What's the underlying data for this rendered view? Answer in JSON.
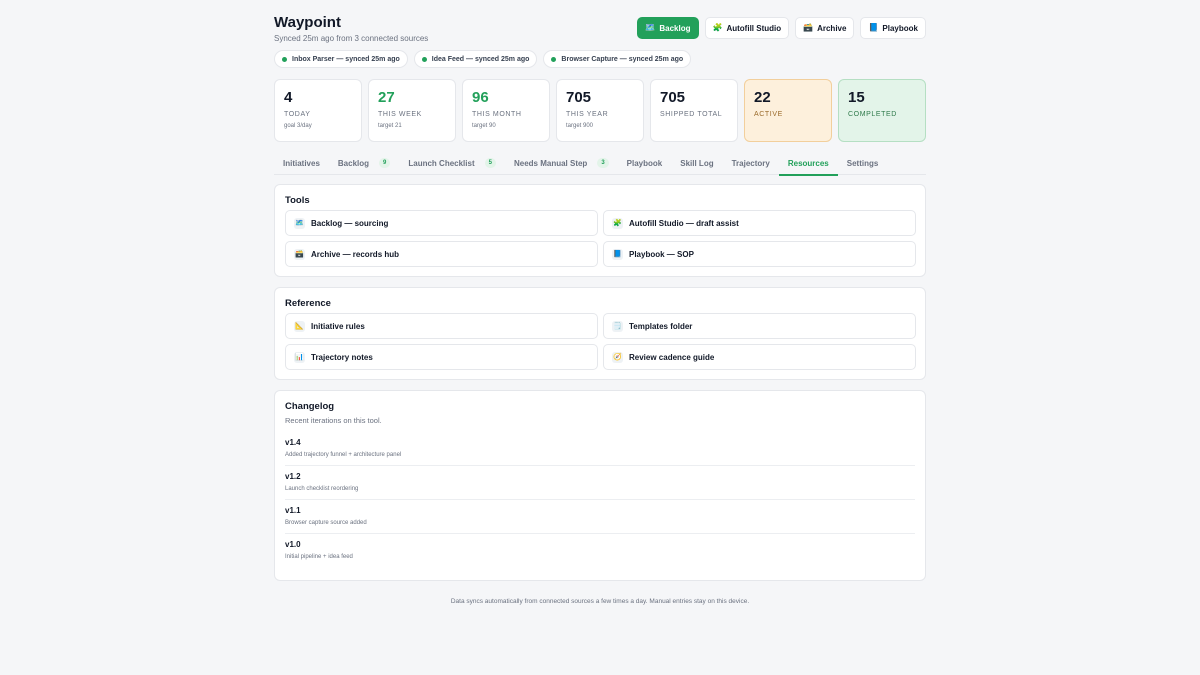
{
  "app": {
    "title": "Waypoint",
    "subtitle": "Synced 25m ago from 3 connected sources"
  },
  "toplinks": [
    {
      "icon": "map-icon",
      "glyph": "🗺️",
      "label": "Backlog",
      "active": true
    },
    {
      "icon": "puzzle-icon",
      "glyph": "🧩",
      "label": "Autofill Studio",
      "active": false
    },
    {
      "icon": "archive-icon",
      "glyph": "🗃️",
      "label": "Archive",
      "active": false
    },
    {
      "icon": "book-icon",
      "glyph": "📘",
      "label": "Playbook",
      "active": false
    }
  ],
  "sources": [
    {
      "label": "Inbox Parser — synced 25m ago"
    },
    {
      "label": "Idea Feed — synced 25m ago"
    },
    {
      "label": "Browser Capture — synced 25m ago"
    }
  ],
  "stats": [
    {
      "value": "4",
      "label": "TODAY",
      "sub": "goal 3/day"
    },
    {
      "value": "27",
      "label": "THIS WEEK",
      "sub": "target 21"
    },
    {
      "value": "96",
      "label": "THIS MONTH",
      "sub": "target 90"
    },
    {
      "value": "705",
      "label": "THIS YEAR",
      "sub": "target 900"
    },
    {
      "value": "705",
      "label": "SHIPPED TOTAL",
      "sub": ""
    },
    {
      "value": "22",
      "label": "ACTIVE",
      "sub": ""
    },
    {
      "value": "15",
      "label": "COMPLETED",
      "sub": ""
    }
  ],
  "tabs": [
    {
      "label": "Initiatives",
      "badge": ""
    },
    {
      "label": "Backlog",
      "badge": "9"
    },
    {
      "label": "Launch Checklist",
      "badge": "5"
    },
    {
      "label": "Needs Manual Step",
      "badge": "3"
    },
    {
      "label": "Playbook",
      "badge": ""
    },
    {
      "label": "Skill Log",
      "badge": ""
    },
    {
      "label": "Trajectory",
      "badge": ""
    },
    {
      "label": "Resources",
      "badge": "",
      "active": true
    },
    {
      "label": "Settings",
      "badge": ""
    }
  ],
  "tools": {
    "heading": "Tools",
    "items": [
      {
        "icon": "map-icon",
        "glyph": "🗺️",
        "label": "Backlog — sourcing"
      },
      {
        "icon": "puzzle-icon",
        "glyph": "🧩",
        "label": "Autofill Studio — draft assist"
      },
      {
        "icon": "archive-icon",
        "glyph": "🗃️",
        "label": "Archive — records hub"
      },
      {
        "icon": "book-icon",
        "glyph": "📘",
        "label": "Playbook — SOP"
      }
    ]
  },
  "reference": {
    "heading": "Reference",
    "items": [
      {
        "icon": "ruler-icon",
        "glyph": "📐",
        "label": "Initiative rules"
      },
      {
        "icon": "notepad-icon",
        "glyph": "🗒️",
        "label": "Templates folder"
      },
      {
        "icon": "bar-chart-icon",
        "glyph": "📊",
        "label": "Trajectory notes"
      },
      {
        "icon": "compass-icon",
        "glyph": "🧭",
        "label": "Review cadence guide"
      }
    ]
  },
  "changelog": {
    "heading": "Changelog",
    "description": "Recent iterations on this tool.",
    "entries": [
      {
        "version": "v1.4",
        "note": "Added trajectory funnel + architecture panel"
      },
      {
        "version": "v1.2",
        "note": "Launch checklist reordering"
      },
      {
        "version": "v1.1",
        "note": "Browser capture source added"
      },
      {
        "version": "v1.0",
        "note": "Initial pipeline + idea feed"
      }
    ]
  },
  "footer": "Data syncs automatically from connected sources a few times a day. Manual entries stay on this device.",
  "colors": {
    "accent": "#22a05a",
    "active_bg": "#fdf0dc",
    "completed_bg": "#e3f4e9"
  }
}
